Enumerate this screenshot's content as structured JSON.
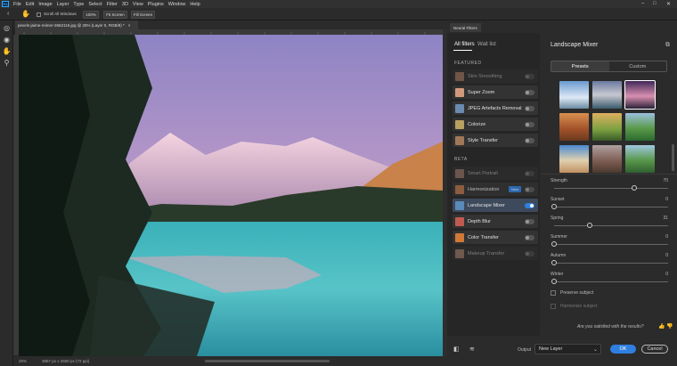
{
  "menubar": {
    "logo": "Ps",
    "items": [
      "File",
      "Edit",
      "Image",
      "Layer",
      "Type",
      "Select",
      "Filter",
      "3D",
      "View",
      "Plugins",
      "Window",
      "Help"
    ],
    "controls": [
      "–",
      "□",
      "✕"
    ]
  },
  "options": {
    "scroll_all": "Scroll All Windows",
    "zoom": "100%",
    "fit_screen": "Fit Screen",
    "fill_screen": "Fill Screen"
  },
  "document": {
    "tab_title": "pexels-jaime-reimer-2662116.jpg @ 25% (Layer 0, RGB/8) *",
    "close_glyph": "×",
    "status_zoom": "25%",
    "status_info": "3867 px x 2600 px (72 ppi)"
  },
  "neural": {
    "panel_title": "Neural Filters",
    "tab_all": "All filters",
    "tab_wait": "Wait list",
    "featured_label": "FEATURED",
    "beta_label": "BETA",
    "featured": [
      {
        "name": "Skin Smoothing",
        "enabled": false,
        "state": "disabled"
      },
      {
        "name": "Super Zoom",
        "enabled": false,
        "state": "normal"
      },
      {
        "name": "JPEG Artefacts Removal",
        "enabled": false,
        "state": "normal"
      },
      {
        "name": "Colorize",
        "enabled": false,
        "state": "normal"
      },
      {
        "name": "Style Transfer",
        "enabled": false,
        "state": "normal"
      }
    ],
    "beta": [
      {
        "name": "Smart Portrait",
        "enabled": false,
        "state": "disabled"
      },
      {
        "name": "Harmonization",
        "enabled": false,
        "state": "disabled",
        "badge": "New"
      },
      {
        "name": "Landscape Mixer",
        "enabled": true,
        "state": "selected"
      },
      {
        "name": "Depth Blur",
        "enabled": false,
        "state": "normal"
      },
      {
        "name": "Color Transfer",
        "enabled": false,
        "state": "normal"
      },
      {
        "name": "Makeup Transfer",
        "enabled": false,
        "state": "disabled"
      }
    ]
  },
  "mixer": {
    "title": "Landscape Mixer",
    "tab_presets": "Presets",
    "tab_custom": "Custom",
    "sliders": [
      {
        "label": "Strength",
        "value": "70",
        "fraction": 0.7
      },
      {
        "label": "Sunset",
        "value": "0",
        "fraction": 0.0
      },
      {
        "label": "Spring",
        "value": "31",
        "fraction": 0.31
      },
      {
        "label": "Summer",
        "value": "0",
        "fraction": 0.0
      },
      {
        "label": "Autumn",
        "value": "0",
        "fraction": 0.0
      },
      {
        "label": "Winter",
        "value": "0",
        "fraction": 0.0
      }
    ],
    "preserve_subject": "Preserve subject",
    "harmonize_subject": "Harmonize subject"
  },
  "footer": {
    "feedback": "Are you satisfied with the results?",
    "output_label": "Output",
    "output_value": "New Layer",
    "ok": "OK",
    "cancel": "Cancel"
  },
  "colors": {
    "accent": "#2f7fe0",
    "panel": "#2b2b2b"
  }
}
